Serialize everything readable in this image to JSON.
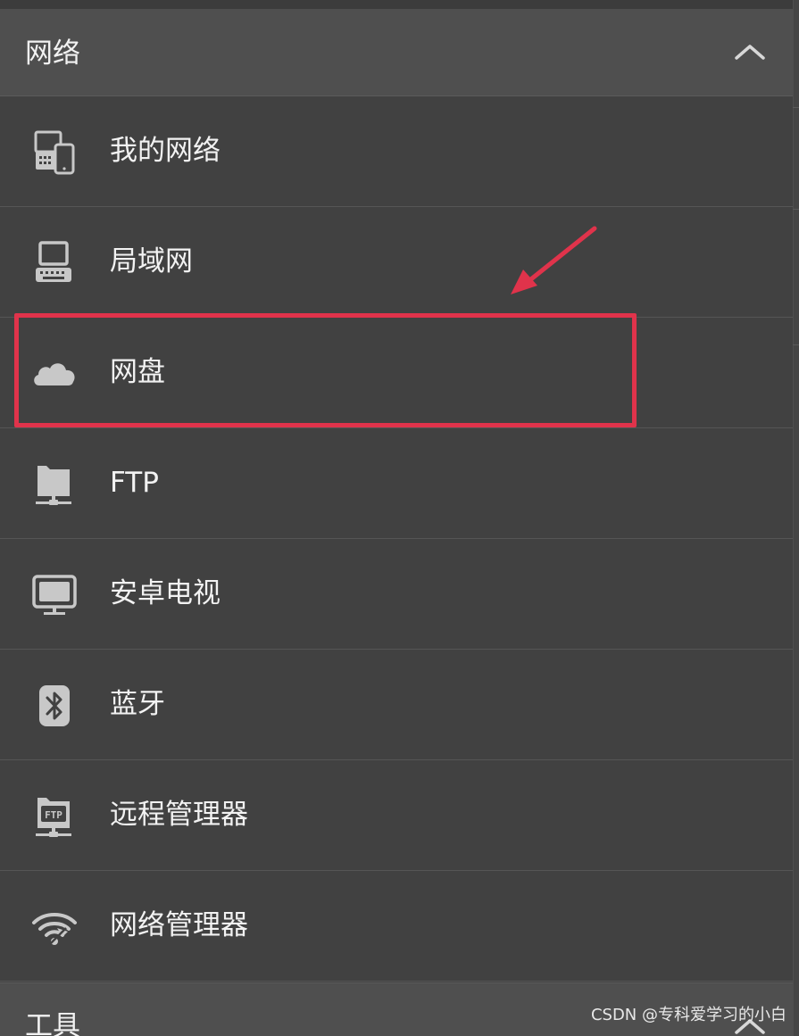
{
  "network_section": {
    "title": "网络",
    "toggle_icon": "chevron-up-icon"
  },
  "items": [
    {
      "label": "我的网络",
      "icon": "devices-icon"
    },
    {
      "label": "局域网",
      "icon": "computer-icon"
    },
    {
      "label": "网盘",
      "icon": "cloud-icon"
    },
    {
      "label": "FTP",
      "icon": "ftp-server-icon"
    },
    {
      "label": "安卓电视",
      "icon": "tv-icon"
    },
    {
      "label": "蓝牙",
      "icon": "bluetooth-icon"
    },
    {
      "label": "远程管理器",
      "icon": "ftp-remote-icon"
    },
    {
      "label": "网络管理器",
      "icon": "wifi-share-icon"
    }
  ],
  "tools_section": {
    "title": "工具",
    "toggle_icon": "chevron-up-icon"
  },
  "annotation": {
    "highlight_color": "#e0334b",
    "highlighted_item": "网盘"
  },
  "watermark": "CSDN @专科爱学习的小白"
}
